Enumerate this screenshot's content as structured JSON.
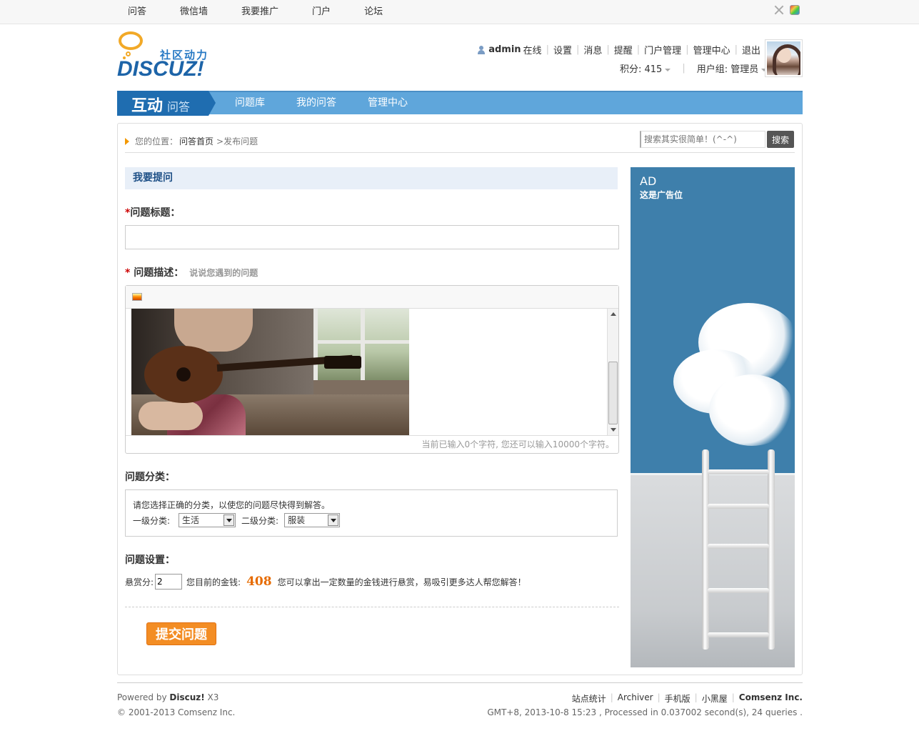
{
  "topnav": [
    "问答",
    "微信墙",
    "我要推广",
    "门户",
    "论坛"
  ],
  "logo": {
    "sub": "社区动力",
    "main": "DISCUZ!"
  },
  "user": {
    "name": "admin",
    "status": "在线",
    "links": [
      "设置",
      "消息",
      "提醒",
      "门户管理",
      "管理中心",
      "退出"
    ],
    "points_label": "积分: 415",
    "group_label": "用户组: 管理员"
  },
  "bluenav": {
    "brand_main": "互动",
    "brand_sub": "问答",
    "items": [
      "问题库",
      "我的问答",
      "管理中心"
    ]
  },
  "breadcrumb": {
    "prefix": "您的位置：",
    "home": "问答首页",
    "current": ">发布问题"
  },
  "search": {
    "placeholder": "搜索其实很简单！(^-^)",
    "button": "搜索"
  },
  "form": {
    "section_title": "我要提问",
    "title_label": "问题标题：",
    "desc_label": "问题描述：",
    "desc_hint": "说说您遇到的问题",
    "counter": "当前已输入0个字符, 您还可以输入10000个字符。",
    "category_label": "问题分类：",
    "category_tip": "请您选择正确的分类，以使您的问题尽快得到解答。",
    "cat1_label": "一级分类:",
    "cat1_value": "生活",
    "cat2_label": "二级分类:",
    "cat2_value": "服装",
    "settings_label": "问题设置：",
    "reward_label": "悬赏分:",
    "reward_value": "2",
    "money_label": "您目前的金钱:",
    "money_value": "408",
    "reward_tip": "您可以拿出一定数量的金钱进行悬赏，易吸引更多达人帮您解答！",
    "submit": "提交问题"
  },
  "ad": {
    "title": "AD",
    "subtitle": "这是广告位"
  },
  "footer": {
    "powered_prefix": "Powered by ",
    "powered_brand": "Discuz!",
    "powered_version": " X3",
    "copyright": "© 2001-2013 Comsenz Inc.",
    "links": [
      "站点统计",
      "Archiver",
      "手机版",
      "小黑屋"
    ],
    "company": "Comsenz Inc.",
    "stats": "GMT+8, 2013-10-8 15:23 , Processed in 0.037002 second(s), 24 queries ."
  }
}
